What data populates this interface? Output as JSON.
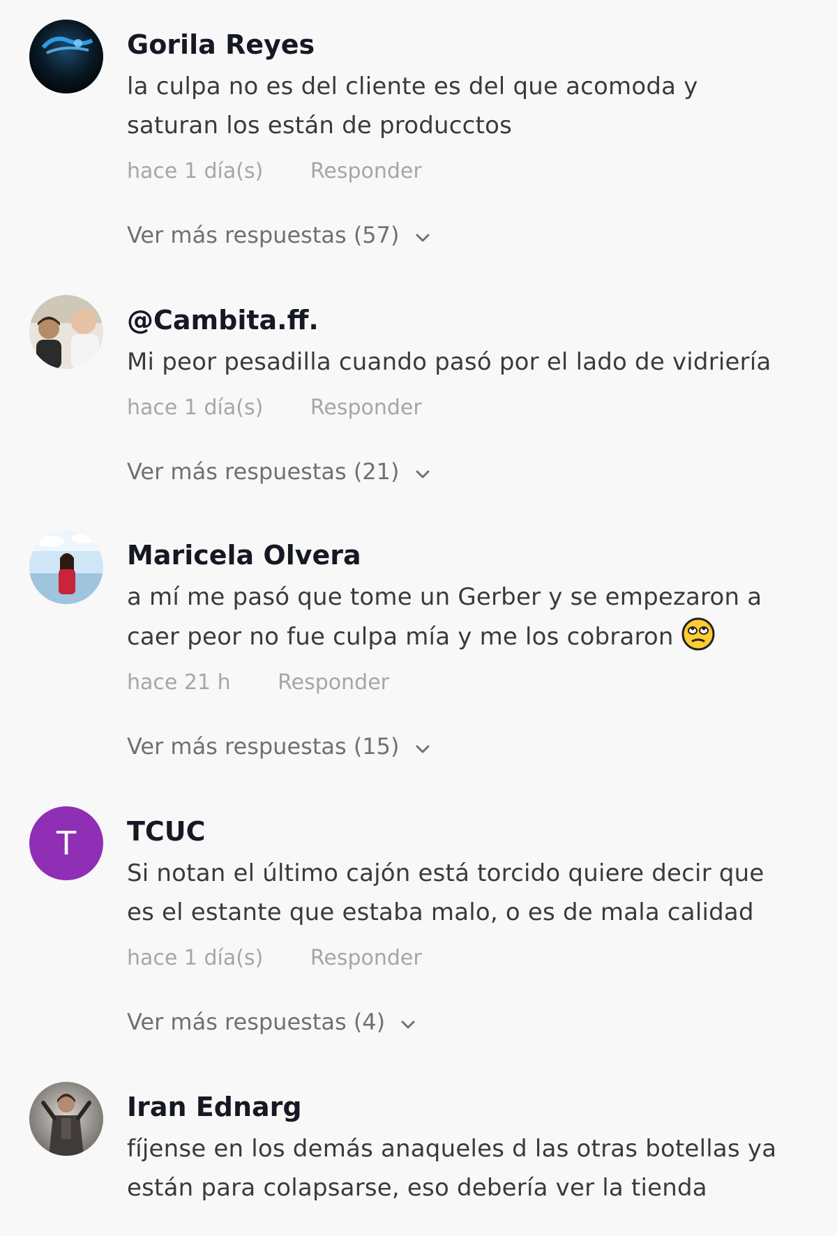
{
  "comments": [
    {
      "username": "Gorila Reyes",
      "text_lines": [
        "la culpa no es del cliente es del que acomoda y",
        "saturan los están de producctos"
      ],
      "time": "hace 1 día(s)",
      "reply_label": "Responder",
      "more_replies": "Ver más respuestas (57)",
      "avatar_icon": "dark-blue-abstract-avatar"
    },
    {
      "username": "@Cambita.ff.",
      "text_lines": [
        "Mi peor pesadilla cuando pasó por el lado de vidriería"
      ],
      "time": "hace 1 día(s)",
      "reply_label": "Responder",
      "more_replies": "Ver más respuestas (21)",
      "avatar_icon": "two-people-photo-avatar"
    },
    {
      "username": "Maricela Olvera",
      "text_lines": [
        "a mí me pasó que tome un Gerber y se empezaron a",
        "caer peor no fue culpa mía y me los cobraron"
      ],
      "emoji_icon": "rolling-eyes-emoji-icon",
      "time": "hace 21 h",
      "reply_label": "Responder",
      "more_replies": "Ver más respuestas (15)",
      "avatar_icon": "beach-person-photo-avatar"
    },
    {
      "username": "TCUC",
      "text_lines": [
        "Si notan el último cajón está torcido quiere decir que",
        "es el estante que estaba malo, o es de mala calidad"
      ],
      "time": "hace 1 día(s)",
      "reply_label": "Responder",
      "more_replies": "Ver más respuestas (4)",
      "avatar_letter": "T",
      "avatar_color": "#8e2fb5"
    },
    {
      "username": "Iran Ednarg",
      "text_lines": [
        "fíjense en los demás anaqueles d las otras botellas ya",
        "están para colapsarse, eso debería ver la tienda"
      ],
      "avatar_icon": "warrior-figure-avatar"
    }
  ],
  "colors": {
    "background": "#f8f8f8",
    "username": "#161823",
    "text": "#3a3a3a",
    "meta": "#a6a6a8",
    "more": "#707070"
  }
}
